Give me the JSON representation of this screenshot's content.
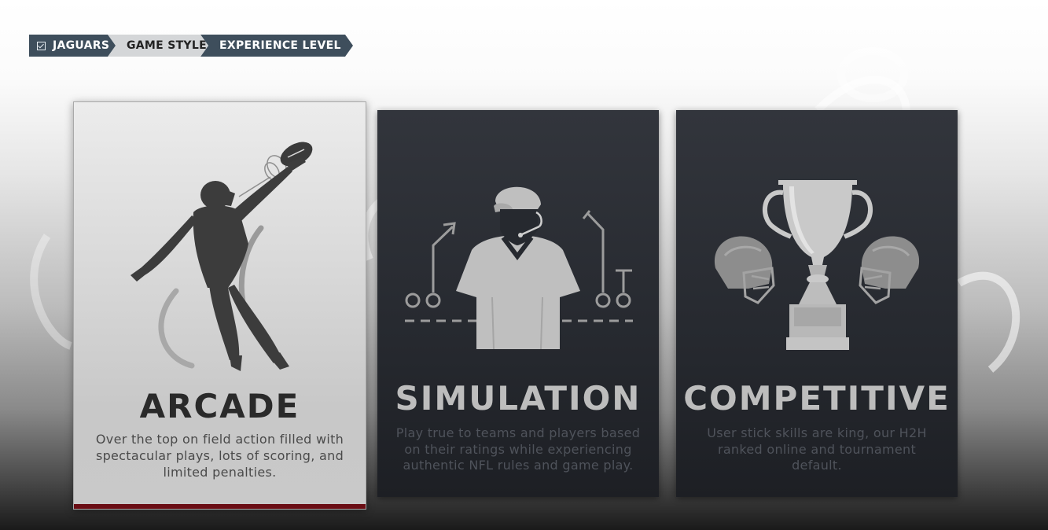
{
  "breadcrumb": {
    "items": [
      {
        "label": "JAGUARS",
        "icon": "checkbox-icon"
      },
      {
        "label": "GAME STYLE"
      },
      {
        "label": "EXPERIENCE LEVEL"
      }
    ]
  },
  "cards": [
    {
      "id": "arcade",
      "title": "ARCADE",
      "description": "Over the top on field action filled with spectacular plays, lots of scoring, and limited penalties.",
      "icon": "football-catch-icon",
      "selected": true
    },
    {
      "id": "simulation",
      "title": "SIMULATION",
      "description": "Play true to teams and players based on their ratings while experiencing authentic NFL rules and game play.",
      "icon": "coach-playbook-icon",
      "selected": false
    },
    {
      "id": "competitive",
      "title": "COMPETITIVE",
      "description": "User stick skills are king, our H2H ranked online and tournament default.",
      "icon": "trophy-helmets-icon",
      "selected": false
    }
  ],
  "colors": {
    "breadcrumb_dark": "#3e4e5c",
    "breadcrumb_light": "#d4d6d8",
    "selected_accent": "#6a0d14",
    "card_dark": "#26292f"
  }
}
